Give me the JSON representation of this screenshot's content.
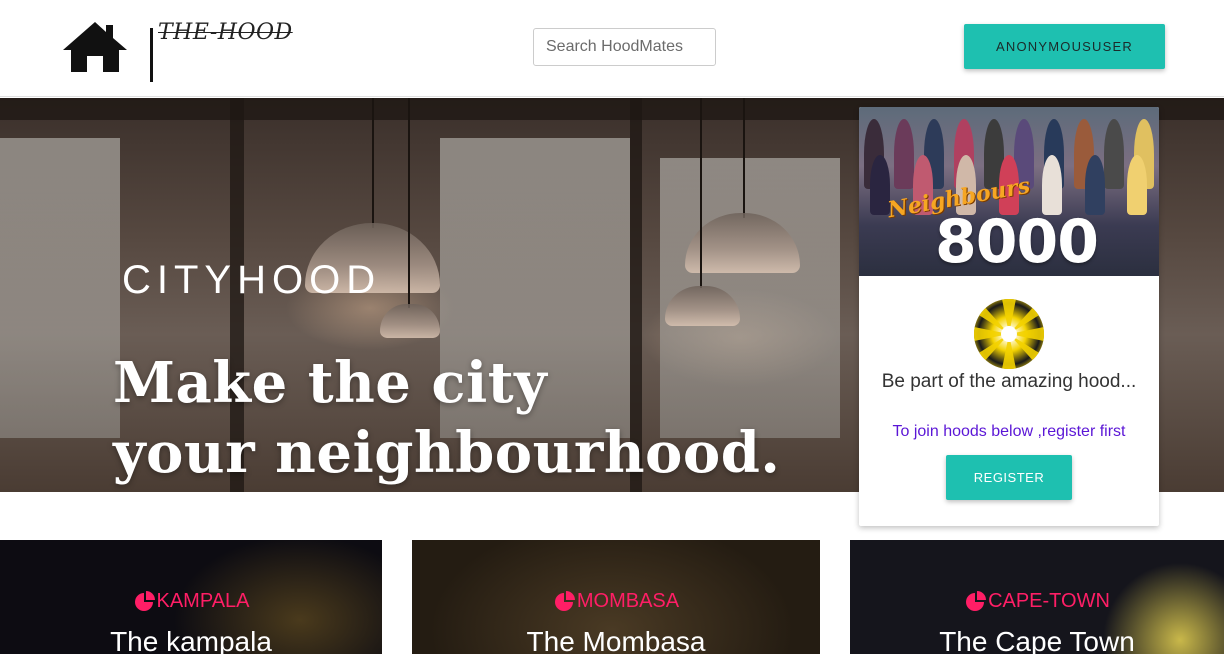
{
  "navbar": {
    "brand": "THE-HOOD",
    "search": {
      "placeholder": "Search HoodMates",
      "value": ""
    },
    "user_button": "ANONYMOUSUSER"
  },
  "hero": {
    "logo": "CITYHOOD",
    "headline_line1": "Make the city",
    "headline_line2": "your neighbourhood."
  },
  "card": {
    "image_script": "Neighbours",
    "image_number": "8000",
    "tagline": "Be part of the amazing hood...",
    "instruction": "To join hoods below ,register first",
    "register_label": "REGISTER"
  },
  "cities": [
    {
      "tag": "KAMPALA",
      "title": "The kampala"
    },
    {
      "tag": "MOMBASA",
      "title": "The Mombasa"
    },
    {
      "tag": "CAPE-TOWN",
      "title": "The Cape Town"
    }
  ],
  "colors": {
    "accent": "#1ec0b0",
    "city_tag": "#ff1e66",
    "instruction_text": "#5b16d6"
  }
}
